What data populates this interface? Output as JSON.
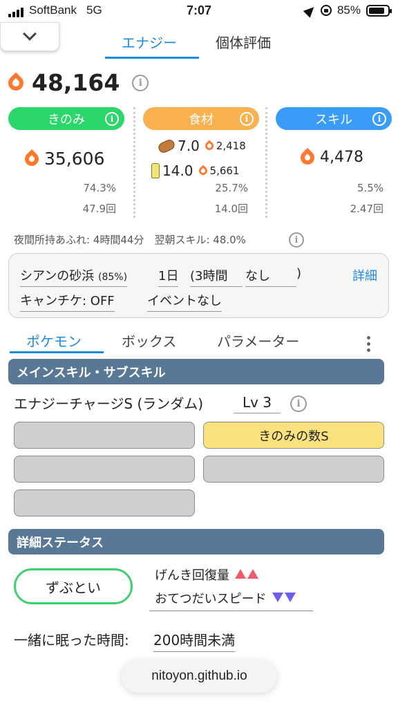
{
  "status_bar": {
    "carrier": "SoftBank",
    "network": "5G",
    "time": "7:07",
    "battery": "85%",
    "battery_fraction": 0.85
  },
  "top_tabs": [
    {
      "label": "エナジー",
      "active": true
    },
    {
      "label": "個体評価",
      "active": false
    }
  ],
  "total_energy": "48,164",
  "columns": {
    "berry": {
      "label": "きのみ",
      "color": "#2bd66a",
      "energy": "35,606",
      "percent": "74.3%",
      "count": "47.9回"
    },
    "ingredient": {
      "label": "食材",
      "color": "#f9b14f",
      "items": [
        {
          "name": "potato-icon",
          "amount": "7.0",
          "energy": "2,418"
        },
        {
          "name": "oil-bottle-icon",
          "amount": "14.0",
          "energy": "5,661"
        }
      ],
      "percent": "25.7%",
      "count": "14.0回"
    },
    "skill": {
      "label": "スキル",
      "color": "#3a9cf6",
      "energy": "4,478",
      "percent": "5.5%",
      "count": "2.47回"
    }
  },
  "night_info": "夜間所持あふれ: 4時間44分　翌朝スキル: 48.0%",
  "settings": {
    "field": "シアンの砂浜",
    "field_bonus": "(85%)",
    "day": "1日",
    "time_range": "(3時間",
    "event_time": "なし",
    "close_paren": ")",
    "detail_link": "詳細",
    "camp_ticket": "キャンチケ: OFF",
    "event": "イベントなし"
  },
  "sub_tabs": [
    {
      "label": "ポケモン",
      "active": true
    },
    {
      "label": "ボックス",
      "active": false
    },
    {
      "label": "パラメーター",
      "active": false
    }
  ],
  "sections": {
    "skills_title": "メインスキル・サブスキル",
    "details_title": "詳細ステータス"
  },
  "main_skill": {
    "name": "エナジーチャージS (ランダム)",
    "level": "Lv 3"
  },
  "sub_skill_slots": [
    "",
    "きのみの数S",
    "",
    "",
    ""
  ],
  "nature": {
    "name": "ずぶとい",
    "up_effect": "げんき回復量",
    "down_effect": "おてつだいスピード"
  },
  "sleep": {
    "label": "一緒に眠った時間:",
    "value": "200時間未満"
  },
  "url": "nitoyon.github.io"
}
